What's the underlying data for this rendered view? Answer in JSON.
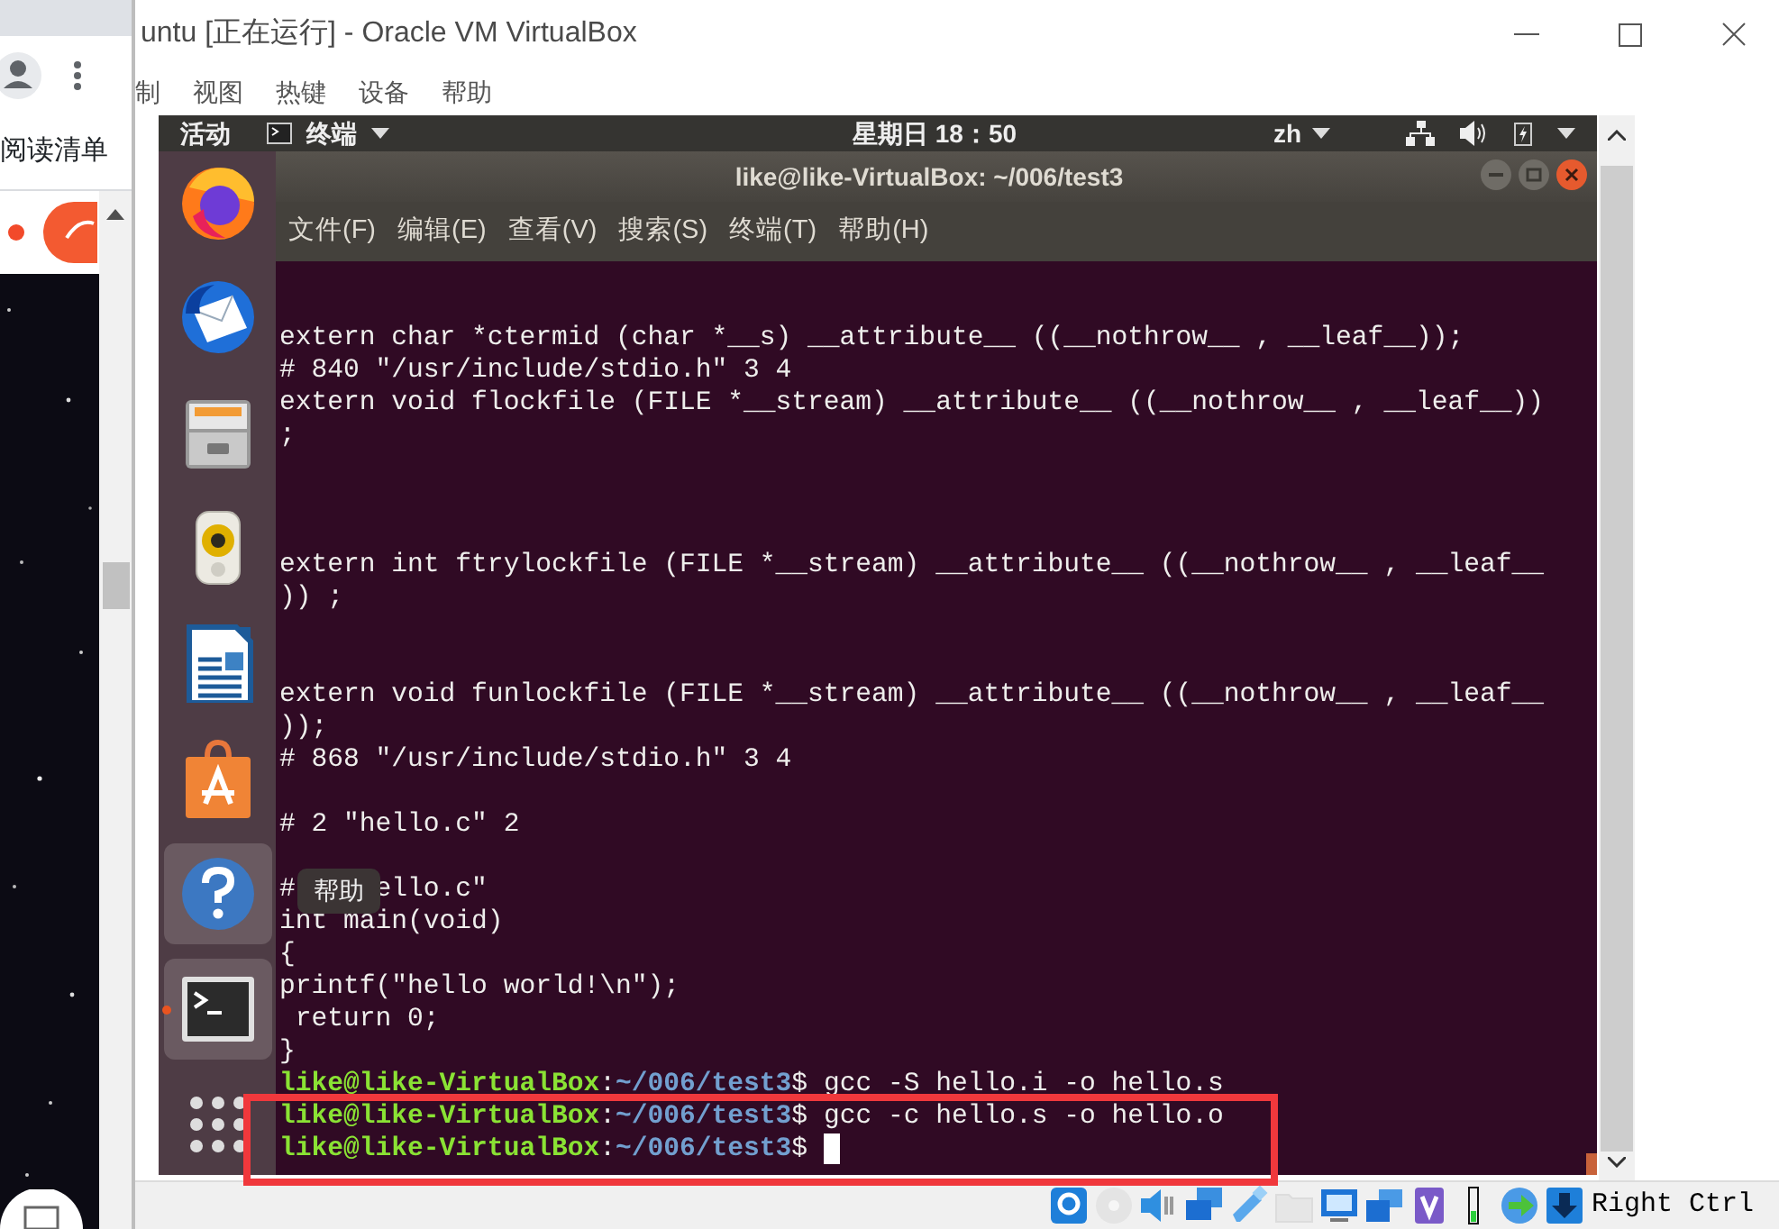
{
  "browser": {
    "menu_item": "阅读清单"
  },
  "window": {
    "title": "untu [正在运行] - Oracle VM VirtualBox",
    "menu": [
      "制",
      "视图",
      "热键",
      "设备",
      "帮助"
    ]
  },
  "top_bar": {
    "activities": "活动",
    "app_menu": "终端",
    "clock": "星期日 18：50",
    "input_method": "zh"
  },
  "dock": {
    "tooltip": "帮助",
    "items": [
      {
        "kind": "firefox",
        "highlighted": false,
        "running": false
      },
      {
        "kind": "mail",
        "highlighted": false,
        "running": false
      },
      {
        "kind": "files",
        "highlighted": false,
        "running": false
      },
      {
        "kind": "music",
        "highlighted": false,
        "running": false
      },
      {
        "kind": "writer",
        "highlighted": false,
        "running": false
      },
      {
        "kind": "software",
        "highlighted": false,
        "running": false
      },
      {
        "kind": "help",
        "highlighted": true,
        "running": false
      },
      {
        "kind": "terminal",
        "highlighted": true,
        "running": true
      },
      {
        "kind": "apps",
        "highlighted": false,
        "running": false
      }
    ]
  },
  "terminal": {
    "title": "like@like-VirtualBox: ~/006/test3",
    "menu": [
      "文件(F)",
      "编辑(E)",
      "查看(V)",
      "搜索(S)",
      "终端(T)",
      "帮助(H)"
    ],
    "lines": [
      {
        "kind": "text",
        "text": "extern char *ctermid (char *__s) __attribute__ ((__nothrow__ , __leaf__));"
      },
      {
        "kind": "text",
        "text": "# 840 \"/usr/include/stdio.h\" 3 4"
      },
      {
        "kind": "text",
        "text": "extern void flockfile (FILE *__stream) __attribute__ ((__nothrow__ , __leaf__))"
      },
      {
        "kind": "text",
        "text": ";"
      },
      {
        "kind": "blank"
      },
      {
        "kind": "blank"
      },
      {
        "kind": "blank"
      },
      {
        "kind": "text",
        "text": "extern int ftrylockfile (FILE *__stream) __attribute__ ((__nothrow__ , __leaf__"
      },
      {
        "kind": "text",
        "text": ")) ;"
      },
      {
        "kind": "blank"
      },
      {
        "kind": "blank"
      },
      {
        "kind": "text",
        "text": "extern void funlockfile (FILE *__stream) __attribute__ ((__nothrow__ , __leaf__"
      },
      {
        "kind": "text",
        "text": "));"
      },
      {
        "kind": "text",
        "text": "# 868 \"/usr/include/stdio.h\" 3 4"
      },
      {
        "kind": "blank"
      },
      {
        "kind": "text",
        "text": "# 2 \"hello.c\" 2"
      },
      {
        "kind": "blank"
      },
      {
        "kind": "covered",
        "before": "#",
        "after": "ello.c\""
      },
      {
        "kind": "text",
        "text": "int main(void)"
      },
      {
        "kind": "text",
        "text": "{"
      },
      {
        "kind": "text",
        "text": "printf(\"hello world!\\n\");"
      },
      {
        "kind": "text",
        "text": " return 0;"
      },
      {
        "kind": "text",
        "text": "}"
      },
      {
        "kind": "prompt",
        "user": "like@like-VirtualBox",
        "sep": ":",
        "path": "~/006/test3",
        "mark": "$",
        "command": "gcc -S hello.i -o hello.s",
        "cursor": false,
        "highlighted": false
      },
      {
        "kind": "prompt",
        "user": "like@like-VirtualBox",
        "sep": ":",
        "path": "~/006/test3",
        "mark": "$",
        "command": "gcc -c hello.s -o hello.o",
        "cursor": false,
        "highlighted": true
      },
      {
        "kind": "prompt",
        "user": "like@like-VirtualBox",
        "sep": ":",
        "path": "~/006/test3",
        "mark": "$",
        "cursor": true,
        "highlighted": true
      }
    ]
  },
  "status_bar": {
    "icons": [
      {
        "kind": "hard-disk",
        "disabled": false
      },
      {
        "kind": "optical",
        "disabled": true
      },
      {
        "kind": "audio",
        "disabled": false
      },
      {
        "kind": "network",
        "disabled": false
      },
      {
        "kind": "usb",
        "disabled": false
      },
      {
        "kind": "shared-folders",
        "disabled": true
      },
      {
        "kind": "display",
        "disabled": false
      },
      {
        "kind": "recording",
        "disabled": false
      },
      {
        "kind": "virtualization",
        "disabled": false
      },
      {
        "kind": "activity",
        "disabled": false
      },
      {
        "kind": "mouse",
        "disabled": false
      },
      {
        "kind": "keyboard",
        "disabled": false
      }
    ],
    "host_key": "Right Ctrl"
  }
}
